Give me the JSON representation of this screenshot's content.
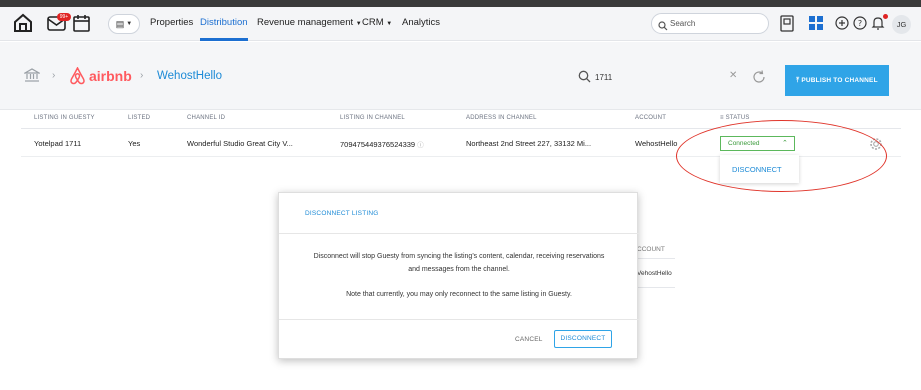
{
  "nav": {
    "notification_badge": "99+",
    "items": [
      {
        "label": "Properties"
      },
      {
        "label": "Distribution"
      },
      {
        "label": "Revenue management"
      },
      {
        "label": "CRM"
      },
      {
        "label": "Analytics"
      }
    ],
    "search_placeholder": "Search",
    "avatar_initials": "JG"
  },
  "channel_header": {
    "brand_name": "airbnb",
    "channel_account": "WehostHello",
    "search_value": "1711",
    "publish_label": "PUBLISH TO CHANNEL"
  },
  "table": {
    "headers": [
      "LISTING IN GUESTY",
      "LISTED",
      "CHANNEL ID",
      "LISTING IN CHANNEL",
      "ADDRESS IN CHANNEL",
      "ACCOUNT",
      "STATUS"
    ],
    "row": {
      "listing_in_guesty": "Yotelpad 1711",
      "listed": "Yes",
      "channel_id": "Wonderful Studio Great City V...",
      "listing_in_channel": "709475449376524339",
      "address": "Northeast 2nd Street 227, 33132 Mi...",
      "account": "WehostHello",
      "status": "Connected"
    },
    "dropdown_option": "DISCONNECT"
  },
  "background_peek": {
    "account_header": "CCOUNT",
    "account_value": "VehostHello"
  },
  "modal": {
    "title": "DISCONNECT LISTING",
    "line1": "Disconnect will stop Guesty from syncing the listing's content, calendar, receiving reservations",
    "line2": "and messages from the channel.",
    "line3": "Note that currently, you may only reconnect to the same listing in Guesty.",
    "cancel_label": "CANCEL",
    "confirm_label": "DISCONNECT"
  },
  "colors": {
    "accent": "#1c6fd1",
    "airbnb": "#ff5a5f",
    "publish": "#2fa4e7",
    "connected": "#5cb85c",
    "annotation": "#e0352b"
  }
}
